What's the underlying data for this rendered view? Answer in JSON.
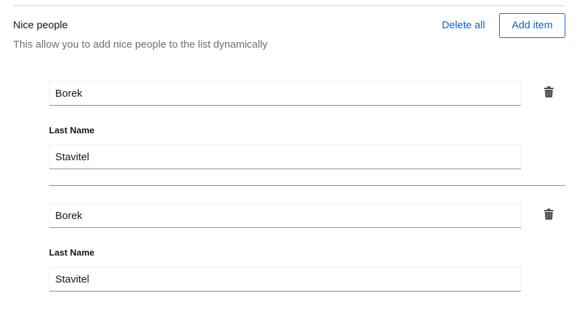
{
  "section": {
    "title": "Nice people",
    "description": "This allow you to add nice people to the list dynamically",
    "delete_all_label": "Delete all",
    "add_item_label": "Add item"
  },
  "entries": [
    {
      "first_name": "Borek",
      "last_name_label": "Last Name",
      "last_name": "Stavitel",
      "remove_icon": "trash-icon"
    },
    {
      "first_name": "Borek",
      "last_name_label": "Last Name",
      "last_name": "Stavitel",
      "remove_icon": "trash-icon"
    }
  ],
  "colors": {
    "link": "#0066cc",
    "description": "#6a6e73",
    "icon": "#4f5255",
    "divider": "#d2d2d2"
  }
}
